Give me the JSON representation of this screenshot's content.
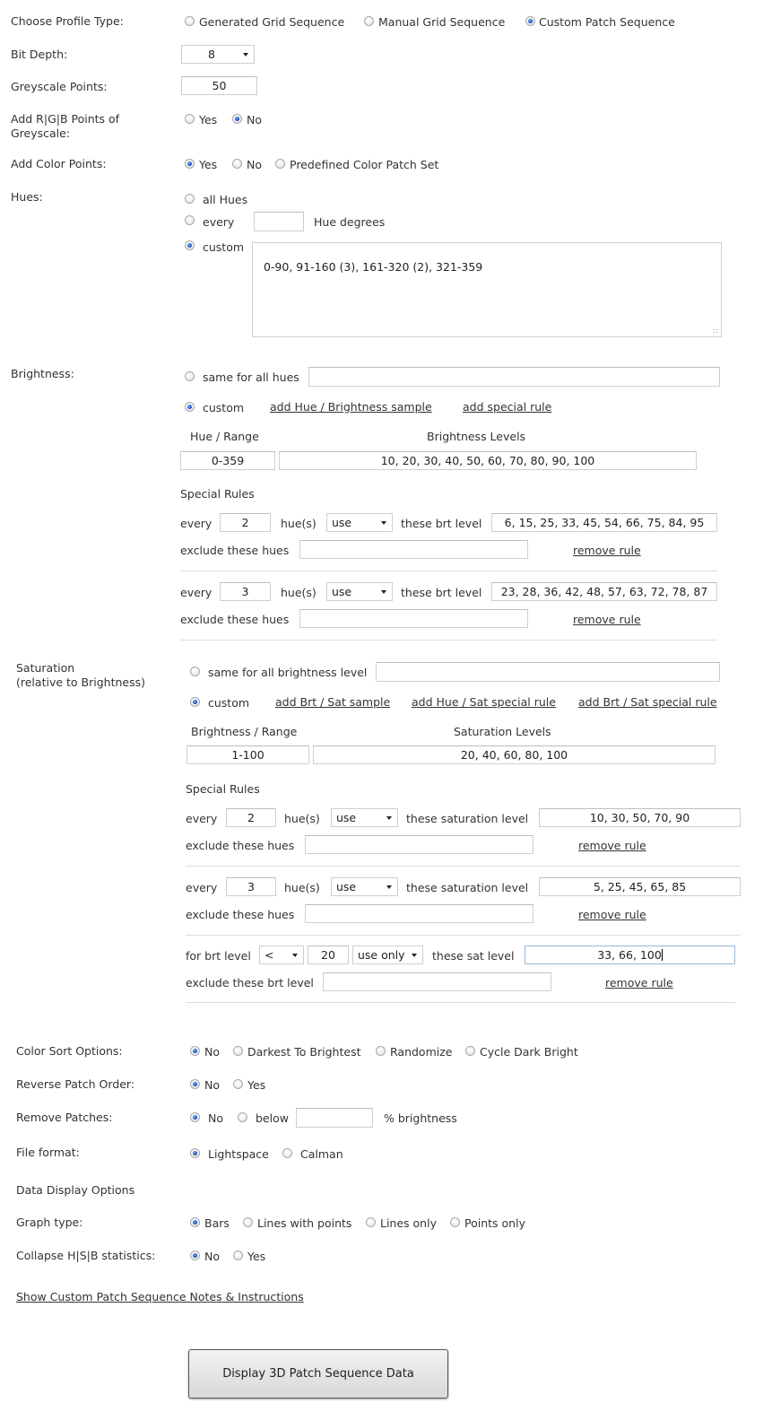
{
  "profile_type": {
    "label": "Choose Profile Type:",
    "options": [
      "Generated Grid Sequence",
      "Manual Grid Sequence",
      "Custom Patch Sequence"
    ],
    "selected": "Custom Patch Sequence"
  },
  "bit_depth": {
    "label": "Bit Depth:",
    "value": "8"
  },
  "greyscale_points": {
    "label": "Greyscale Points:",
    "value": "50"
  },
  "add_rgb_points": {
    "label_line1": "Add R|G|B Points of",
    "label_line2": "Greyscale:",
    "options": [
      "Yes",
      "No"
    ],
    "selected": "No"
  },
  "add_color_points": {
    "label": "Add Color Points:",
    "options": [
      "Yes",
      "No",
      "Predefined Color Patch Set"
    ],
    "selected": "Yes"
  },
  "hues": {
    "label": "Hues:",
    "all_hues_label": "all Hues",
    "every_label": "every",
    "every_value": "",
    "hue_degrees_label": "Hue degrees",
    "custom_label": "custom",
    "custom_value": "0-90, 91-160 (3), 161-320 (2), 321-359",
    "selected": "custom"
  },
  "brightness": {
    "label": "Brightness:",
    "same_label": "same for all hues",
    "same_value": "",
    "custom_label": "custom",
    "selected": "custom",
    "add_sample_link": "add Hue / Brightness sample",
    "add_rule_link": "add special rule",
    "col_range": "Hue / Range",
    "col_levels": "Brightness Levels",
    "samples": [
      {
        "range": "0-359",
        "levels": "10, 20, 30, 40, 50, 60, 70, 80, 90, 100"
      }
    ],
    "special_rules_title": "Special Rules",
    "rules": [
      {
        "every_label": "every",
        "every_value": "2",
        "hues_label": "hue(s)",
        "mode": "use",
        "these_label": "these brt level",
        "levels": "6, 15, 25, 33, 45, 54, 66, 75, 84, 95",
        "exclude_label": "exclude these hues",
        "exclude_value": "",
        "remove_link": "remove rule"
      },
      {
        "every_label": "every",
        "every_value": "3",
        "hues_label": "hue(s)",
        "mode": "use",
        "these_label": "these brt level",
        "levels": "23, 28, 36, 42, 48, 57, 63, 72, 78, 87",
        "exclude_label": "exclude these hues",
        "exclude_value": "",
        "remove_link": "remove rule"
      }
    ]
  },
  "saturation": {
    "label_line1": "Saturation",
    "label_line2": "(relative to Brightness)",
    "same_label": "same for all brightness level",
    "same_value": "",
    "custom_label": "custom",
    "selected": "custom",
    "add_sample_link": "add Brt / Sat sample",
    "add_hue_rule_link": "add Hue / Sat special rule",
    "add_brt_rule_link": "add Brt / Sat special rule",
    "col_range": "Brightness / Range",
    "col_levels": "Saturation Levels",
    "samples": [
      {
        "range": "1-100",
        "levels": "20, 40, 60, 80, 100"
      }
    ],
    "special_rules_title": "Special Rules",
    "hue_rules": [
      {
        "every_label": "every",
        "every_value": "2",
        "hues_label": "hue(s)",
        "mode": "use",
        "these_label": "these saturation level",
        "levels": "10, 30, 50, 70, 90",
        "exclude_label": "exclude these hues",
        "exclude_value": "",
        "remove_link": "remove rule"
      },
      {
        "every_label": "every",
        "every_value": "3",
        "hues_label": "hue(s)",
        "mode": "use",
        "these_label": "these saturation level",
        "levels": "5, 25, 45, 65, 85",
        "exclude_label": "exclude these hues",
        "exclude_value": "",
        "remove_link": "remove rule"
      }
    ],
    "brt_rule": {
      "for_label": "for brt level",
      "operator": "<",
      "value": "20",
      "mode": "use only",
      "these_label": "these sat level",
      "levels": "33, 66, 100",
      "exclude_label": "exclude these brt level",
      "exclude_value": "",
      "remove_link": "remove rule"
    }
  },
  "color_sort": {
    "label": "Color Sort Options:",
    "options": [
      "No",
      "Darkest To Brightest",
      "Randomize",
      "Cycle Dark Bright"
    ],
    "selected": "No"
  },
  "reverse_order": {
    "label": "Reverse Patch Order:",
    "options": [
      "No",
      "Yes"
    ],
    "selected": "No"
  },
  "remove_patches": {
    "label": "Remove Patches:",
    "no_label": "No",
    "below_label": "below",
    "below_value": "",
    "suffix": "% brightness",
    "selected": "No"
  },
  "file_format": {
    "label": "File format:",
    "options": [
      "Lightspace",
      "Calman"
    ],
    "selected": "Lightspace"
  },
  "data_display": {
    "title": "Data Display Options"
  },
  "graph_type": {
    "label": "Graph type:",
    "options": [
      "Bars",
      "Lines with points",
      "Lines only",
      "Points only"
    ],
    "selected": "Bars"
  },
  "collapse_stats": {
    "label": "Collapse H|S|B statistics:",
    "options": [
      "No",
      "Yes"
    ],
    "selected": "No"
  },
  "notes_link": "Show Custom Patch Sequence Notes & Instructions",
  "submit_button": "Display 3D Patch Sequence Data"
}
